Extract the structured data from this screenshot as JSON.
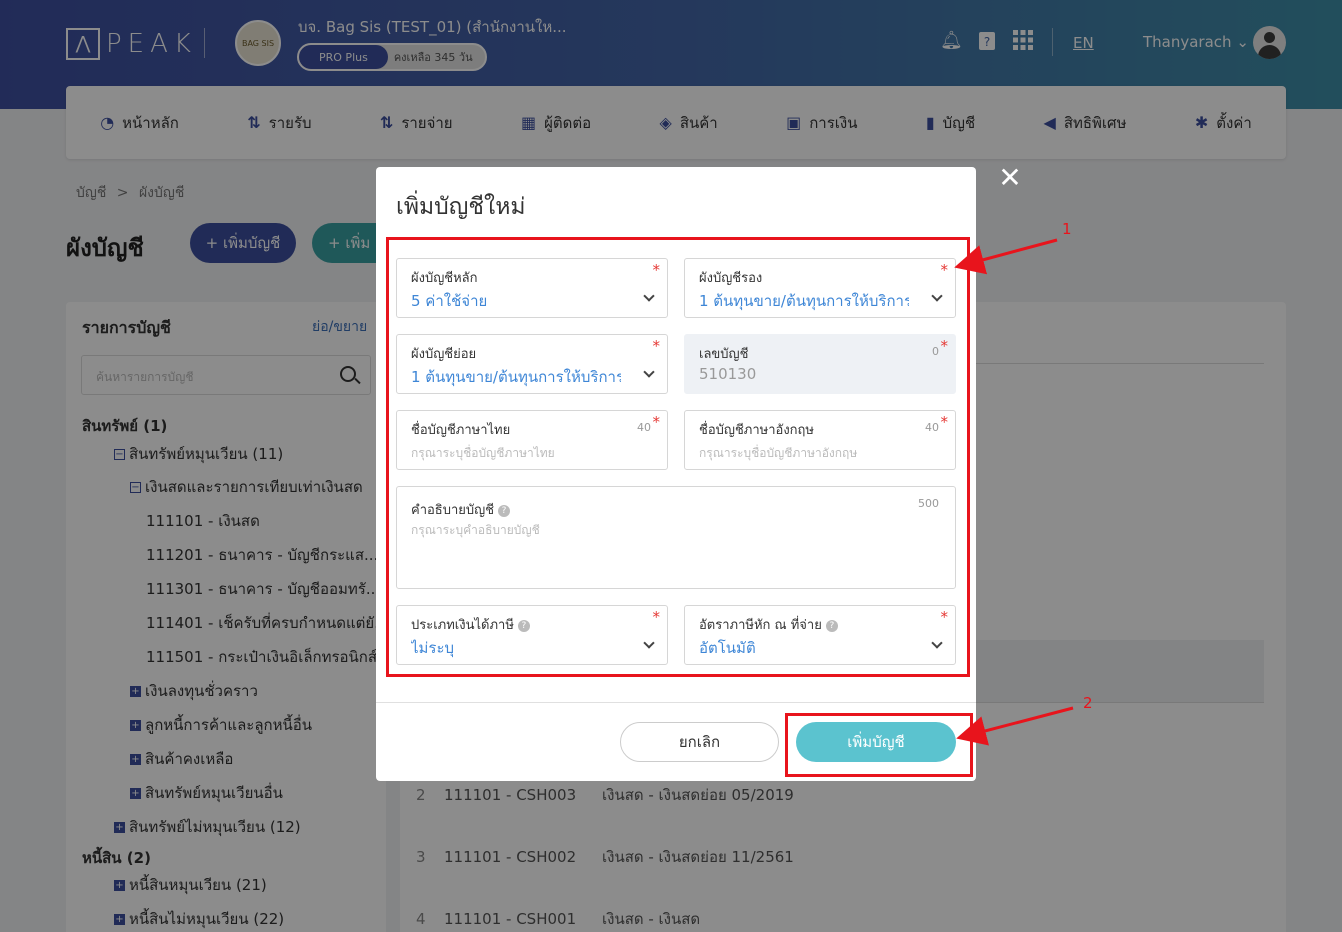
{
  "header": {
    "logo_text": "PEAK",
    "company_name": "บจ. Bag Sis (TEST_01) (สำนักงานให...",
    "company_logo_text": "BAG SIS",
    "plan": "PRO Plus",
    "days_left": "คงเหลือ 345 วัน",
    "language": "EN",
    "user_name": "Thanyarach"
  },
  "nav": [
    {
      "label": "หน้าหลัก",
      "icon": "dashboard-icon"
    },
    {
      "label": "รายรับ",
      "icon": "income-icon"
    },
    {
      "label": "รายจ่าย",
      "icon": "expense-icon"
    },
    {
      "label": "ผู้ติดต่อ",
      "icon": "contacts-icon"
    },
    {
      "label": "สินค้า",
      "icon": "product-box-icon"
    },
    {
      "label": "การเงิน",
      "icon": "money-icon"
    },
    {
      "label": "บัญชี",
      "icon": "account-book-icon"
    },
    {
      "label": "สิทธิพิเศษ",
      "icon": "megaphone-icon"
    },
    {
      "label": "ตั้งค่า",
      "icon": "gear-icon"
    }
  ],
  "breadcrumb": {
    "root": "บัญชี",
    "sep": ">",
    "current": "ผังบัญชี"
  },
  "page": {
    "title": "ผังบัญชี",
    "add_account_button": "+ เพิ่มบัญชี",
    "add_other_button": "+ เพิ่ม"
  },
  "left_panel": {
    "title": "รายการบัญชี",
    "toggle": "ย่อ/ขยาย",
    "search_placeholder": "ค้นหารายการบัญชี",
    "tree": [
      {
        "label": "สินทรัพย์ (1)",
        "level": 0,
        "exp": ""
      },
      {
        "label": "สินทรัพย์หมุนเวียน (11)",
        "level": 1,
        "exp": "−"
      },
      {
        "label": "เงินสดและรายการเทียบเท่าเงินสด",
        "level": 2,
        "exp": "−"
      },
      {
        "label": "111101 - เงินสด",
        "level": 3,
        "exp": ""
      },
      {
        "label": "111201 - ธนาคาร - บัญชีกระแส...",
        "level": 3,
        "exp": ""
      },
      {
        "label": "111301 - ธนาคาร - บัญชีออมทรั...",
        "level": 3,
        "exp": ""
      },
      {
        "label": "111401 - เช็ครับที่ครบกำหนดแต่ยั...",
        "level": 3,
        "exp": ""
      },
      {
        "label": "111501 - กระเป๋าเงินอิเล็กทรอนิกส์",
        "level": 3,
        "exp": ""
      },
      {
        "label": "เงินลงทุนชั่วคราว",
        "level": 2,
        "exp": "+"
      },
      {
        "label": "ลูกหนี้การค้าและลูกหนี้อื่น",
        "level": 2,
        "exp": "+"
      },
      {
        "label": "สินค้าคงเหลือ",
        "level": 2,
        "exp": "+"
      },
      {
        "label": "สินทรัพย์หมุนเวียนอื่น",
        "level": 2,
        "exp": "+"
      },
      {
        "label": "สินทรัพย์ไม่หมุนเวียน (12)",
        "level": 1,
        "exp": "+"
      },
      {
        "label": "หนี้สิน (2)",
        "level": 0,
        "exp": ""
      },
      {
        "label": "หนี้สินหมุนเวียน (21)",
        "level": 1,
        "exp": "+"
      },
      {
        "label": "หนี้สินไม่หมุนเวียน (22)",
        "level": 1,
        "exp": "+"
      }
    ]
  },
  "table_rows": [
    {
      "no": "2",
      "code": "111101 - CSH003",
      "name": "เงินสด - เงินสดย่อย 05/2019"
    },
    {
      "no": "3",
      "code": "111101 - CSH002",
      "name": "เงินสด - เงินสดย่อย 11/2561"
    },
    {
      "no": "4",
      "code": "111101 - CSH001",
      "name": "เงินสด - เงินสด"
    }
  ],
  "modal": {
    "title": "เพิ่มบัญชีใหม่",
    "main_chart_label": "ผังบัญชีหลัก",
    "main_chart_value": "5 ค่าใช้จ่าย",
    "sub_chart_label": "ผังบัญชีรอง",
    "sub_chart_value": "1 ต้นทุนขาย/ต้นทุนการให้บริการ...",
    "minor_chart_label": "ผังบัญชีย่อย",
    "minor_chart_value": "1 ต้นทุนขาย/ต้นทุนการให้บริการ",
    "account_no_label": "เลขบัญชี",
    "account_no_count": "0",
    "account_no_value": "510130",
    "thai_name_label": "ชื่อบัญชีภาษาไทย",
    "thai_name_count": "40",
    "thai_name_placeholder": "กรุณาระบุชื่อบัญชีภาษาไทย",
    "eng_name_label": "ชื่อบัญชีภาษาอังกฤษ",
    "eng_name_count": "40",
    "eng_name_placeholder": "กรุณาระบุชื่อบัญชีภาษาอังกฤษ",
    "desc_label": "คำอธิบายบัญชี",
    "desc_count": "500",
    "desc_placeholder": "กรุณาระบุคำอธิบายบัญชี",
    "income_type_label": "ประเภทเงินได้ภาษี",
    "income_type_value": "ไม่ระบุ",
    "wht_rate_label": "อัตราภาษีหัก ณ ที่จ่าย",
    "wht_rate_value": "อัตโนมัติ",
    "cancel_button": "ยกเลิก",
    "submit_button": "เพิ่มบัญชี",
    "required_mark": "*",
    "close": "✕"
  },
  "annotations": {
    "label_1": "1",
    "label_2": "2",
    "color": "#e8141c"
  }
}
